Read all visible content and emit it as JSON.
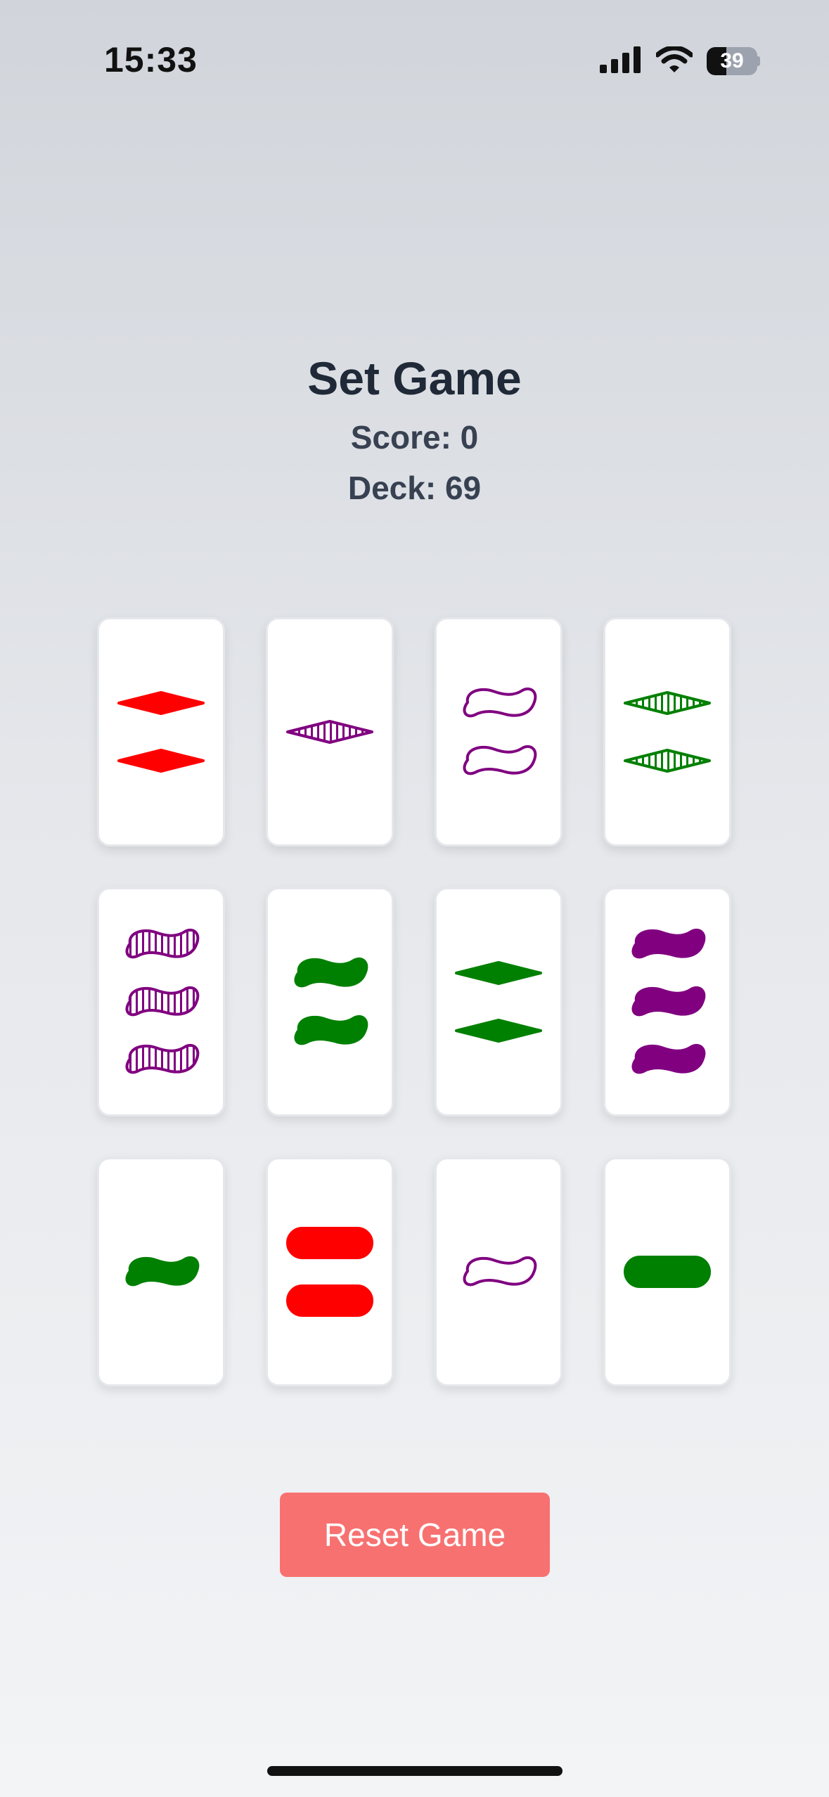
{
  "status_bar": {
    "time": "15:33",
    "battery_level": "39",
    "battery_fraction": 0.39,
    "icons": [
      "signal-icon",
      "wifi-icon",
      "battery-icon"
    ]
  },
  "game": {
    "title": "Set Game",
    "score_text": "Score: 0",
    "deck_text": "Deck: 69"
  },
  "colors": {
    "red": "#ff0000",
    "purple": "#800080",
    "green": "#008000",
    "button": "#f87171"
  },
  "cards": [
    {
      "count": 2,
      "shape": "diamond",
      "color": "red",
      "shading": "solid"
    },
    {
      "count": 1,
      "shape": "diamond",
      "color": "purple",
      "shading": "striped"
    },
    {
      "count": 2,
      "shape": "squiggle",
      "color": "purple",
      "shading": "open"
    },
    {
      "count": 2,
      "shape": "diamond",
      "color": "green",
      "shading": "striped"
    },
    {
      "count": 3,
      "shape": "squiggle",
      "color": "purple",
      "shading": "striped"
    },
    {
      "count": 2,
      "shape": "squiggle",
      "color": "green",
      "shading": "solid"
    },
    {
      "count": 2,
      "shape": "diamond",
      "color": "green",
      "shading": "solid"
    },
    {
      "count": 3,
      "shape": "squiggle",
      "color": "purple",
      "shading": "solid"
    },
    {
      "count": 1,
      "shape": "squiggle",
      "color": "green",
      "shading": "solid"
    },
    {
      "count": 2,
      "shape": "oval",
      "color": "red",
      "shading": "solid"
    },
    {
      "count": 1,
      "shape": "squiggle",
      "color": "purple",
      "shading": "open"
    },
    {
      "count": 1,
      "shape": "oval",
      "color": "green",
      "shading": "solid"
    }
  ],
  "reset_button": {
    "label": "Reset Game"
  }
}
